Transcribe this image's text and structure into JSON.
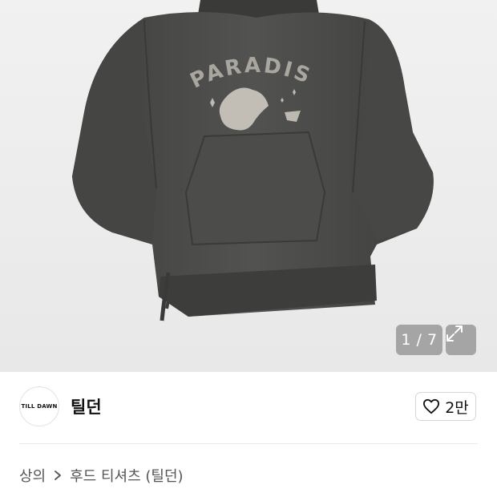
{
  "gallery": {
    "counter": "1 / 7",
    "graphic_text": "PARADISE",
    "background": "#eeeeee",
    "garment_color": "#4b4b49"
  },
  "brand": {
    "logo_text": "TILL DAWN",
    "name": "틸던"
  },
  "like": {
    "icon": "heart-icon",
    "count": "2만"
  },
  "breadcrumb": {
    "category": "상의",
    "separator_icon": "chevron-right-icon",
    "product_title": "후드 티셔츠 (틸던)"
  }
}
